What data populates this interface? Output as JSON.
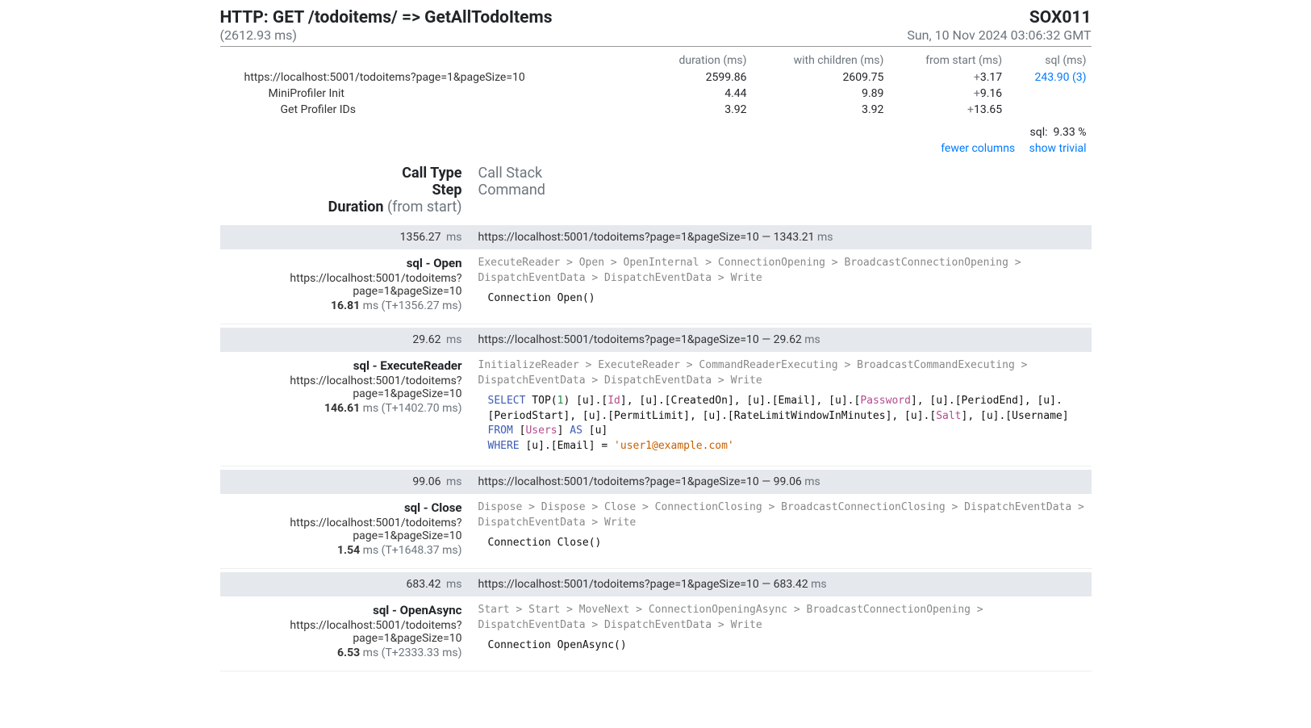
{
  "header": {
    "title": "HTTP: GET /todoitems/ => GetAllTodoItems",
    "machine": "SOX011",
    "total_ms": "(2612.93 ms)",
    "timestamp": "Sun, 10 Nov 2024 03:06:32 GMT"
  },
  "columns": {
    "c0": "",
    "c1": "duration (ms)",
    "c2": "with children (ms)",
    "c3": "from start (ms)",
    "c4": "sql (ms)"
  },
  "timings": [
    {
      "label": "https://localhost:5001/todoitems?page=1&pageSize=10",
      "indent": 0,
      "duration": "2599.86",
      "with_children": "2609.75",
      "from_start": "3.17",
      "sql": "243.90 (3)"
    },
    {
      "label": "MiniProfiler Init",
      "indent": 1,
      "duration": "4.44",
      "with_children": "9.89",
      "from_start": "9.16",
      "sql": ""
    },
    {
      "label": "Get Profiler IDs",
      "indent": 2,
      "duration": "3.92",
      "with_children": "3.92",
      "from_start": "13.65",
      "sql": ""
    }
  ],
  "totals": {
    "label": "sql:",
    "pct": "9.33 %"
  },
  "links": {
    "fewer": "fewer columns",
    "trivial": "show trivial"
  },
  "section_header": {
    "left": [
      {
        "bold": "Call Type",
        "muted": ""
      },
      {
        "bold": "Step",
        "muted": ""
      },
      {
        "bold": "Duration",
        "muted": " (from start)"
      }
    ],
    "right": [
      "Call Stack",
      "Command",
      ""
    ]
  },
  "entries": [
    {
      "gap": {
        "time": "1356.27",
        "unit": "ms",
        "desc": "https://localhost:5001/todoitems?page=1&pageSize=10 — 1343.21",
        "desc_unit": "ms"
      },
      "type": "sql - Open",
      "url": "https://localhost:5001/todoitems?page=1&pageSize=10",
      "dur": "16.81",
      "dur_unit": "ms",
      "from": "(T+1356.27 ms)",
      "callstack": "ExecuteReader > Open > OpenInternal > ConnectionOpening > BroadcastConnectionOpening > DispatchEventData > DispatchEventData > Write",
      "command_plain": "Connection Open()"
    },
    {
      "gap": {
        "time": "29.62",
        "unit": "ms",
        "desc": "https://localhost:5001/todoitems?page=1&pageSize=10 — 29.62",
        "desc_unit": "ms"
      },
      "type": "sql - ExecuteReader",
      "url": "https://localhost:5001/todoitems?page=1&pageSize=10",
      "dur": "146.61",
      "dur_unit": "ms",
      "from": "(T+1402.70 ms)",
      "callstack": "InitializeReader > ExecuteReader > CommandReaderExecuting > BroadcastCommandExecuting > DispatchEventData > DispatchEventData > Write",
      "command_sql": true
    },
    {
      "gap": {
        "time": "99.06",
        "unit": "ms",
        "desc": "https://localhost:5001/todoitems?page=1&pageSize=10 — 99.06",
        "desc_unit": "ms"
      },
      "type": "sql - Close",
      "url": "https://localhost:5001/todoitems?page=1&pageSize=10",
      "dur": "1.54",
      "dur_unit": "ms",
      "from": "(T+1648.37 ms)",
      "callstack": "Dispose > Dispose > Close > ConnectionClosing > BroadcastConnectionClosing > DispatchEventData > DispatchEventData > Write",
      "command_plain": "Connection Close()"
    },
    {
      "gap": {
        "time": "683.42",
        "unit": "ms",
        "desc": "https://localhost:5001/todoitems?page=1&pageSize=10 — 683.42",
        "desc_unit": "ms"
      },
      "type": "sql - OpenAsync",
      "url": "https://localhost:5001/todoitems?page=1&pageSize=10",
      "dur": "6.53",
      "dur_unit": "ms",
      "from": "(T+2333.33 ms)",
      "callstack": "Start > Start > MoveNext > ConnectionOpeningAsync > BroadcastConnectionOpening > DispatchEventData > DispatchEventData > Write",
      "command_plain": "Connection OpenAsync()"
    }
  ],
  "sql_highlight": {
    "line1_pre": "SELECT",
    "top": " TOP(",
    "one": "1",
    "after_top": ") [u].[",
    "id": "Id",
    "mid1": "], [u].[CreatedOn], [u].[Email], [u].[",
    "pw": "Password",
    "mid2": "], [u].[PeriodEnd], [u].[PeriodStart], [u].[PermitLimit], [u].[RateLimitWindowInMinutes], [u].[",
    "salt": "Salt",
    "mid3": "], [u].[Username]",
    "from": "FROM",
    "after_from": " [",
    "users": "Users",
    "after_users": "] ",
    "as": "AS",
    "after_as": " [u]",
    "where": "WHERE",
    "after_where": " [u].[Email] = ",
    "str": "'user1@example.com'"
  }
}
